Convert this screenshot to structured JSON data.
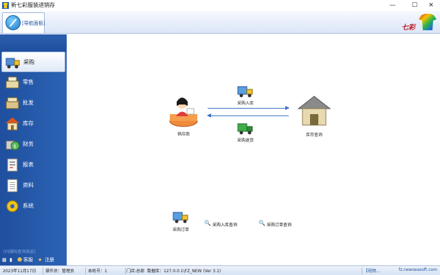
{
  "window": {
    "title": "新七彩服装进销存",
    "controls": {
      "minimize": "—",
      "maximize": "☐",
      "close": "✕"
    }
  },
  "navbar": {
    "nav_button_label": "[导航面板]",
    "brand_text": "七彩"
  },
  "sidebar": {
    "items": [
      {
        "label": "采购",
        "icon": "truck-icon",
        "active": true
      },
      {
        "label": "零售",
        "icon": "cash-register-icon",
        "active": false
      },
      {
        "label": "批发",
        "icon": "wholesale-icon",
        "active": false
      },
      {
        "label": "库存",
        "icon": "warehouse-icon",
        "active": false
      },
      {
        "label": "财务",
        "icon": "finance-icon",
        "active": false
      },
      {
        "label": "报表",
        "icon": "report-icon",
        "active": false
      },
      {
        "label": "资料",
        "icon": "document-icon",
        "active": false
      },
      {
        "label": "系统",
        "icon": "gear-icon",
        "active": false
      }
    ],
    "hint": "[扫描码查询商品]",
    "tools": {
      "service": "客服",
      "register": "注册"
    }
  },
  "main": {
    "nodes": {
      "supplier": "供应商",
      "warehouse": "库存查询"
    },
    "flows": {
      "purchase_in": "采购入库",
      "purchase_return": "采购退货"
    },
    "links": {
      "purchase_order": "采购订单",
      "purchase_in_query": "采购入库查询",
      "purchase_order_query": "采购订单查询"
    }
  },
  "statusbar": {
    "date": "2023年11月17日",
    "operator": "操作员：管理员",
    "machine": "本机号：1",
    "store": "门店:总部",
    "database": "数据库：127.0.0.1\\FZ_NEW (Ver 3.1)",
    "video": "【视频...",
    "website": "fz.newseasoft.com"
  },
  "colors": {
    "sidebar": "#2c63b5",
    "accent": "#3b6fc4",
    "brand_red": "#c0202a"
  }
}
